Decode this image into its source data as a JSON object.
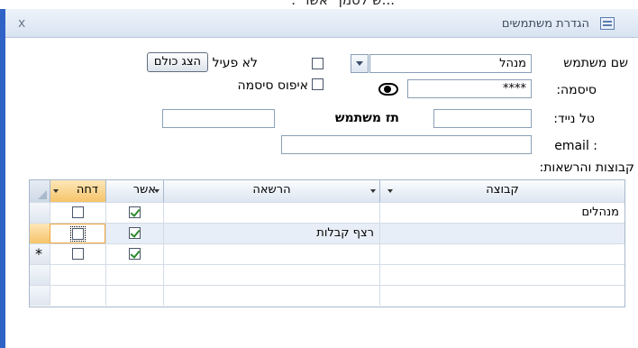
{
  "top_fragment": "...ש לסמן \"אשר\".",
  "window": {
    "title": "הגדרת משתמשים",
    "close_glyph": "x"
  },
  "form": {
    "username_label": "שם משתמש",
    "username_value": "מנהל",
    "inactive_label": "לא פעיל",
    "show_all_label": "הצג כולם",
    "password_label": "סיסמה:",
    "password_value": "****",
    "reset_password_label": "איפוס סיסמה",
    "mobile_label": "טל נייד:",
    "mobile_value": "",
    "user_id_label": "תז משתמש",
    "user_id_value": "",
    "email_label": ": email",
    "email_value": "",
    "groups_heading": "קבוצות והרשאות:"
  },
  "grid": {
    "columns": [
      {
        "label": "קבוצה"
      },
      {
        "label": "הרשאה"
      },
      {
        "label": "אשר"
      },
      {
        "label": "דחה"
      }
    ],
    "rows": [
      {
        "group": "מנהלים",
        "permission": "",
        "approve": true,
        "reject": false
      },
      {
        "group": "",
        "permission": "רצף קבלות",
        "approve": true,
        "reject": false
      },
      {
        "group": "",
        "permission": "",
        "approve": true,
        "reject": false
      }
    ],
    "new_row_marker": "*"
  },
  "colors": {
    "window_frame": "#2f63c6",
    "titlebar_top": "#eef3fa",
    "selected_header": "#f6c46a",
    "check_mark": "#2b8a2b"
  }
}
